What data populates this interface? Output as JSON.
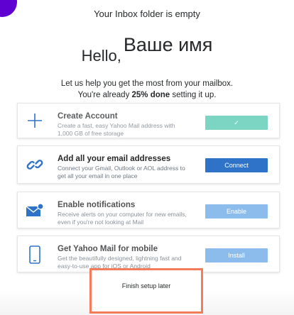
{
  "status": {
    "empty_message": "Your Inbox folder is empty"
  },
  "greeting": {
    "hello": "Hello,",
    "name": "Ваше имя"
  },
  "intro": {
    "line1": "Let us help you get the most from your mailbox.",
    "line2_prefix": "You're already ",
    "line2_bold": "25% done",
    "line2_suffix": " setting it up."
  },
  "cards": [
    {
      "icon": "plus-icon",
      "title": "Create Account",
      "description": "Create a fast, easy Yahoo Mail address with 1,000 GB of free storage",
      "action_label": "✓",
      "action_color": "#7bd5c2",
      "state": "done"
    },
    {
      "icon": "link-icon",
      "title": "Add all your email addresses",
      "description": "Connect your Gmail, Outlook or AOL address to get all your email in one place",
      "action_label": "Connect",
      "action_color": "#2f73c8",
      "state": "active"
    },
    {
      "icon": "envelope-notification-icon",
      "title": "Enable notifications",
      "description": "Receive alerts on your computer for new emails, even if you're not looking at Mail",
      "action_label": "Enable",
      "action_color": "#8cbcec",
      "state": "pending"
    },
    {
      "icon": "mobile-phone-icon",
      "title": "Get Yahoo Mail for mobile",
      "description": "Get the beautifully designed, lightning fast and easy-to-use app for iOS or Android",
      "action_label": "Install",
      "action_color": "#8cbcec",
      "state": "pending"
    }
  ],
  "footer": {
    "finish_later": "Finish setup later",
    "highlight_color": "#f47c5b"
  },
  "colors": {
    "icon_blue": "#2f73c8",
    "brand_purple": "#5f01d1"
  }
}
